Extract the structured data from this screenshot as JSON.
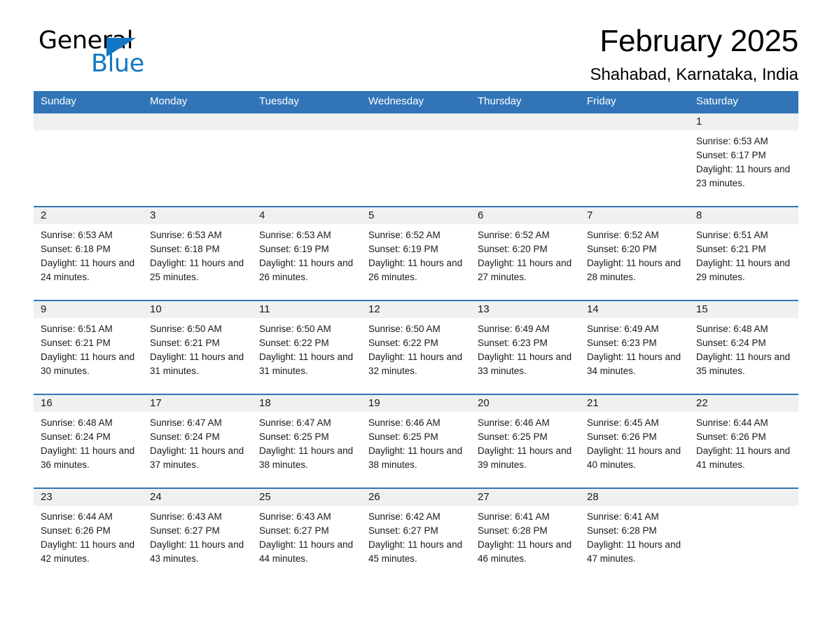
{
  "brand": {
    "name_part1": "General",
    "name_part2": "Blue",
    "triangle_icon": "triangle-icon",
    "accent_color": "#1277c4"
  },
  "header": {
    "title": "February 2025",
    "location": "Shahabad, Karnataka, India"
  },
  "theme": {
    "header_blue": "#3175b8",
    "day_band_gray": "#f0f0f0",
    "text_color": "#1a1a1a"
  },
  "calendar": {
    "weekday_headers": [
      "Sunday",
      "Monday",
      "Tuesday",
      "Wednesday",
      "Thursday",
      "Friday",
      "Saturday"
    ],
    "labels": {
      "sunrise_prefix": "Sunrise:",
      "sunset_prefix": "Sunset:",
      "daylight_prefix": "Daylight:"
    },
    "weeks": [
      [
        {
          "day": "",
          "sunrise": "",
          "sunset": "",
          "daylight": ""
        },
        {
          "day": "",
          "sunrise": "",
          "sunset": "",
          "daylight": ""
        },
        {
          "day": "",
          "sunrise": "",
          "sunset": "",
          "daylight": ""
        },
        {
          "day": "",
          "sunrise": "",
          "sunset": "",
          "daylight": ""
        },
        {
          "day": "",
          "sunrise": "",
          "sunset": "",
          "daylight": ""
        },
        {
          "day": "",
          "sunrise": "",
          "sunset": "",
          "daylight": ""
        },
        {
          "day": "1",
          "sunrise": "Sunrise: 6:53 AM",
          "sunset": "Sunset: 6:17 PM",
          "daylight": "Daylight: 11 hours and 23 minutes."
        }
      ],
      [
        {
          "day": "2",
          "sunrise": "Sunrise: 6:53 AM",
          "sunset": "Sunset: 6:18 PM",
          "daylight": "Daylight: 11 hours and 24 minutes."
        },
        {
          "day": "3",
          "sunrise": "Sunrise: 6:53 AM",
          "sunset": "Sunset: 6:18 PM",
          "daylight": "Daylight: 11 hours and 25 minutes."
        },
        {
          "day": "4",
          "sunrise": "Sunrise: 6:53 AM",
          "sunset": "Sunset: 6:19 PM",
          "daylight": "Daylight: 11 hours and 26 minutes."
        },
        {
          "day": "5",
          "sunrise": "Sunrise: 6:52 AM",
          "sunset": "Sunset: 6:19 PM",
          "daylight": "Daylight: 11 hours and 26 minutes."
        },
        {
          "day": "6",
          "sunrise": "Sunrise: 6:52 AM",
          "sunset": "Sunset: 6:20 PM",
          "daylight": "Daylight: 11 hours and 27 minutes."
        },
        {
          "day": "7",
          "sunrise": "Sunrise: 6:52 AM",
          "sunset": "Sunset: 6:20 PM",
          "daylight": "Daylight: 11 hours and 28 minutes."
        },
        {
          "day": "8",
          "sunrise": "Sunrise: 6:51 AM",
          "sunset": "Sunset: 6:21 PM",
          "daylight": "Daylight: 11 hours and 29 minutes."
        }
      ],
      [
        {
          "day": "9",
          "sunrise": "Sunrise: 6:51 AM",
          "sunset": "Sunset: 6:21 PM",
          "daylight": "Daylight: 11 hours and 30 minutes."
        },
        {
          "day": "10",
          "sunrise": "Sunrise: 6:50 AM",
          "sunset": "Sunset: 6:21 PM",
          "daylight": "Daylight: 11 hours and 31 minutes."
        },
        {
          "day": "11",
          "sunrise": "Sunrise: 6:50 AM",
          "sunset": "Sunset: 6:22 PM",
          "daylight": "Daylight: 11 hours and 31 minutes."
        },
        {
          "day": "12",
          "sunrise": "Sunrise: 6:50 AM",
          "sunset": "Sunset: 6:22 PM",
          "daylight": "Daylight: 11 hours and 32 minutes."
        },
        {
          "day": "13",
          "sunrise": "Sunrise: 6:49 AM",
          "sunset": "Sunset: 6:23 PM",
          "daylight": "Daylight: 11 hours and 33 minutes."
        },
        {
          "day": "14",
          "sunrise": "Sunrise: 6:49 AM",
          "sunset": "Sunset: 6:23 PM",
          "daylight": "Daylight: 11 hours and 34 minutes."
        },
        {
          "day": "15",
          "sunrise": "Sunrise: 6:48 AM",
          "sunset": "Sunset: 6:24 PM",
          "daylight": "Daylight: 11 hours and 35 minutes."
        }
      ],
      [
        {
          "day": "16",
          "sunrise": "Sunrise: 6:48 AM",
          "sunset": "Sunset: 6:24 PM",
          "daylight": "Daylight: 11 hours and 36 minutes."
        },
        {
          "day": "17",
          "sunrise": "Sunrise: 6:47 AM",
          "sunset": "Sunset: 6:24 PM",
          "daylight": "Daylight: 11 hours and 37 minutes."
        },
        {
          "day": "18",
          "sunrise": "Sunrise: 6:47 AM",
          "sunset": "Sunset: 6:25 PM",
          "daylight": "Daylight: 11 hours and 38 minutes."
        },
        {
          "day": "19",
          "sunrise": "Sunrise: 6:46 AM",
          "sunset": "Sunset: 6:25 PM",
          "daylight": "Daylight: 11 hours and 38 minutes."
        },
        {
          "day": "20",
          "sunrise": "Sunrise: 6:46 AM",
          "sunset": "Sunset: 6:25 PM",
          "daylight": "Daylight: 11 hours and 39 minutes."
        },
        {
          "day": "21",
          "sunrise": "Sunrise: 6:45 AM",
          "sunset": "Sunset: 6:26 PM",
          "daylight": "Daylight: 11 hours and 40 minutes."
        },
        {
          "day": "22",
          "sunrise": "Sunrise: 6:44 AM",
          "sunset": "Sunset: 6:26 PM",
          "daylight": "Daylight: 11 hours and 41 minutes."
        }
      ],
      [
        {
          "day": "23",
          "sunrise": "Sunrise: 6:44 AM",
          "sunset": "Sunset: 6:26 PM",
          "daylight": "Daylight: 11 hours and 42 minutes."
        },
        {
          "day": "24",
          "sunrise": "Sunrise: 6:43 AM",
          "sunset": "Sunset: 6:27 PM",
          "daylight": "Daylight: 11 hours and 43 minutes."
        },
        {
          "day": "25",
          "sunrise": "Sunrise: 6:43 AM",
          "sunset": "Sunset: 6:27 PM",
          "daylight": "Daylight: 11 hours and 44 minutes."
        },
        {
          "day": "26",
          "sunrise": "Sunrise: 6:42 AM",
          "sunset": "Sunset: 6:27 PM",
          "daylight": "Daylight: 11 hours and 45 minutes."
        },
        {
          "day": "27",
          "sunrise": "Sunrise: 6:41 AM",
          "sunset": "Sunset: 6:28 PM",
          "daylight": "Daylight: 11 hours and 46 minutes."
        },
        {
          "day": "28",
          "sunrise": "Sunrise: 6:41 AM",
          "sunset": "Sunset: 6:28 PM",
          "daylight": "Daylight: 11 hours and 47 minutes."
        },
        {
          "day": "",
          "sunrise": "",
          "sunset": "",
          "daylight": ""
        }
      ]
    ]
  }
}
